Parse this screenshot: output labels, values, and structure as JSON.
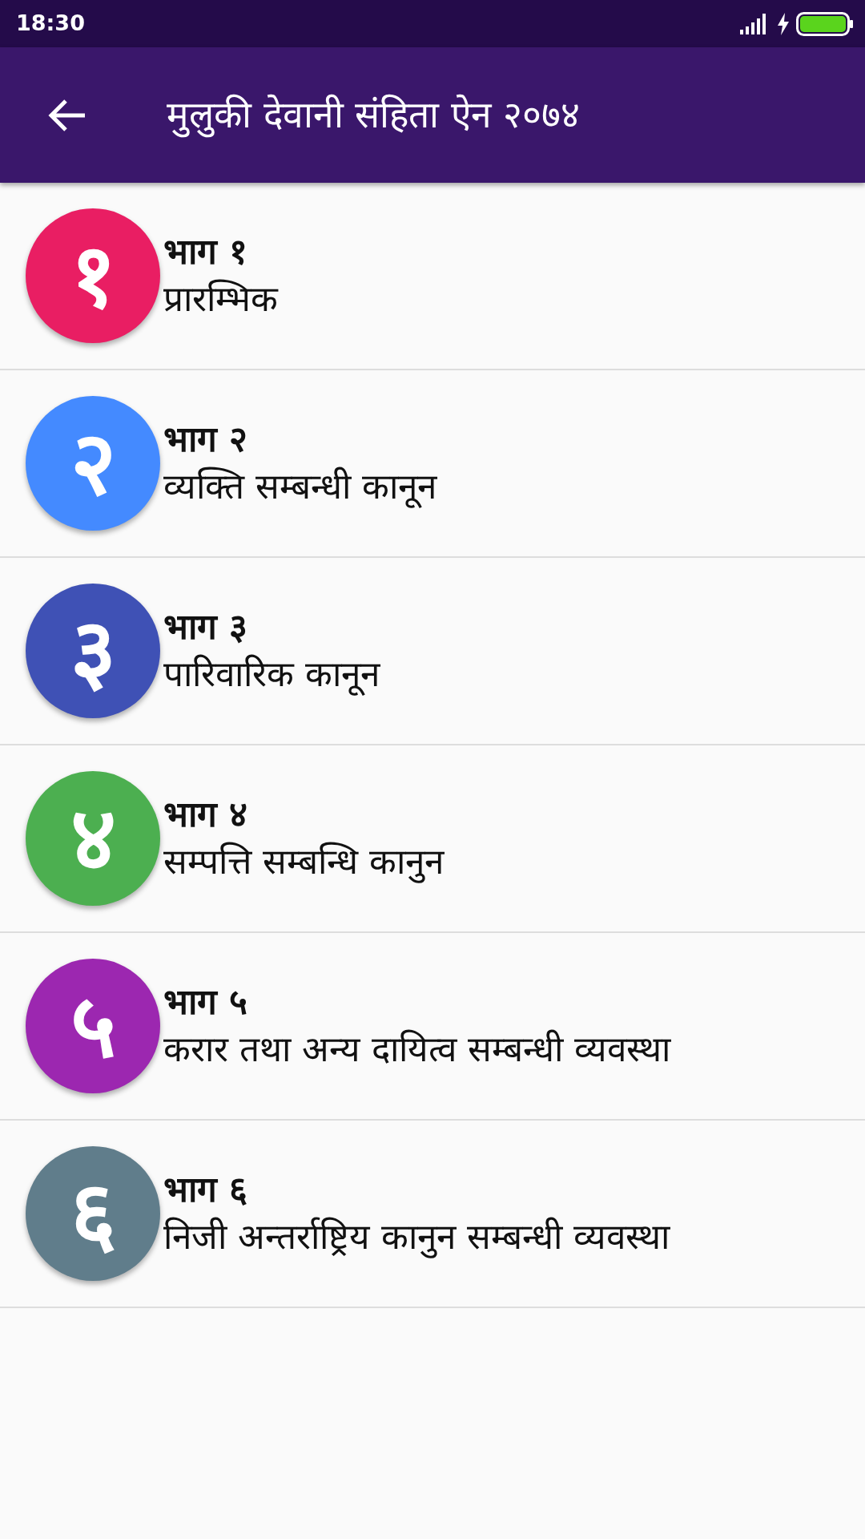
{
  "status_bar": {
    "time": "18:30"
  },
  "app_bar": {
    "title": "मुलुकी देवानी संहिता ऐन २०७४"
  },
  "parts": [
    {
      "badge": "१",
      "color": "#e91e63",
      "title": "भाग १",
      "subtitle": "प्रारम्भिक"
    },
    {
      "badge": "२",
      "color": "#448aff",
      "title": "भाग २",
      "subtitle": "व्यक्ति सम्बन्धी कानून"
    },
    {
      "badge": "३",
      "color": "#3f51b5",
      "title": "भाग ३",
      "subtitle": "पारिवारिक कानून"
    },
    {
      "badge": "४",
      "color": "#4caf50",
      "title": "भाग ४",
      "subtitle": "सम्पत्ति सम्बन्धि कानुन"
    },
    {
      "badge": "५",
      "color": "#9c27b0",
      "title": "भाग ५",
      "subtitle": "करार तथा अन्य दायित्व सम्बन्धी व्यवस्था"
    },
    {
      "badge": "६",
      "color": "#607d8b",
      "title": "भाग ६",
      "subtitle": "निजी अन्तर्राष्ट्रिय कानुन सम्बन्धी व्यवस्था"
    }
  ]
}
